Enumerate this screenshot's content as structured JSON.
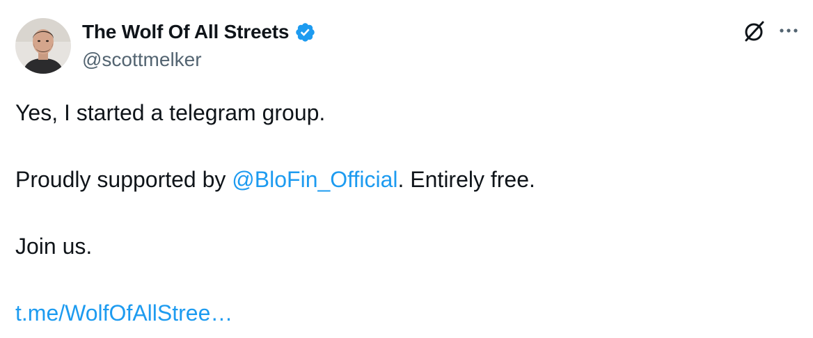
{
  "author": {
    "display_name": "The Wolf Of All Streets",
    "handle": "@scottmelker",
    "verified": true
  },
  "header_icons": [
    "grok-icon",
    "more-options-icon"
  ],
  "more_label": "···",
  "tweet": {
    "line1": "Yes, I started a telegram group.",
    "line2_prefix": "Proudly supported by ",
    "mention": "@BloFin_Official",
    "line2_suffix": ". Entirely free.",
    "line3": "Join us.",
    "link_text": "t.me/WolfOfAllStree…"
  },
  "colors": {
    "accent": "#1d9bf0",
    "text": "#0f1419",
    "secondary_text": "#536471"
  }
}
